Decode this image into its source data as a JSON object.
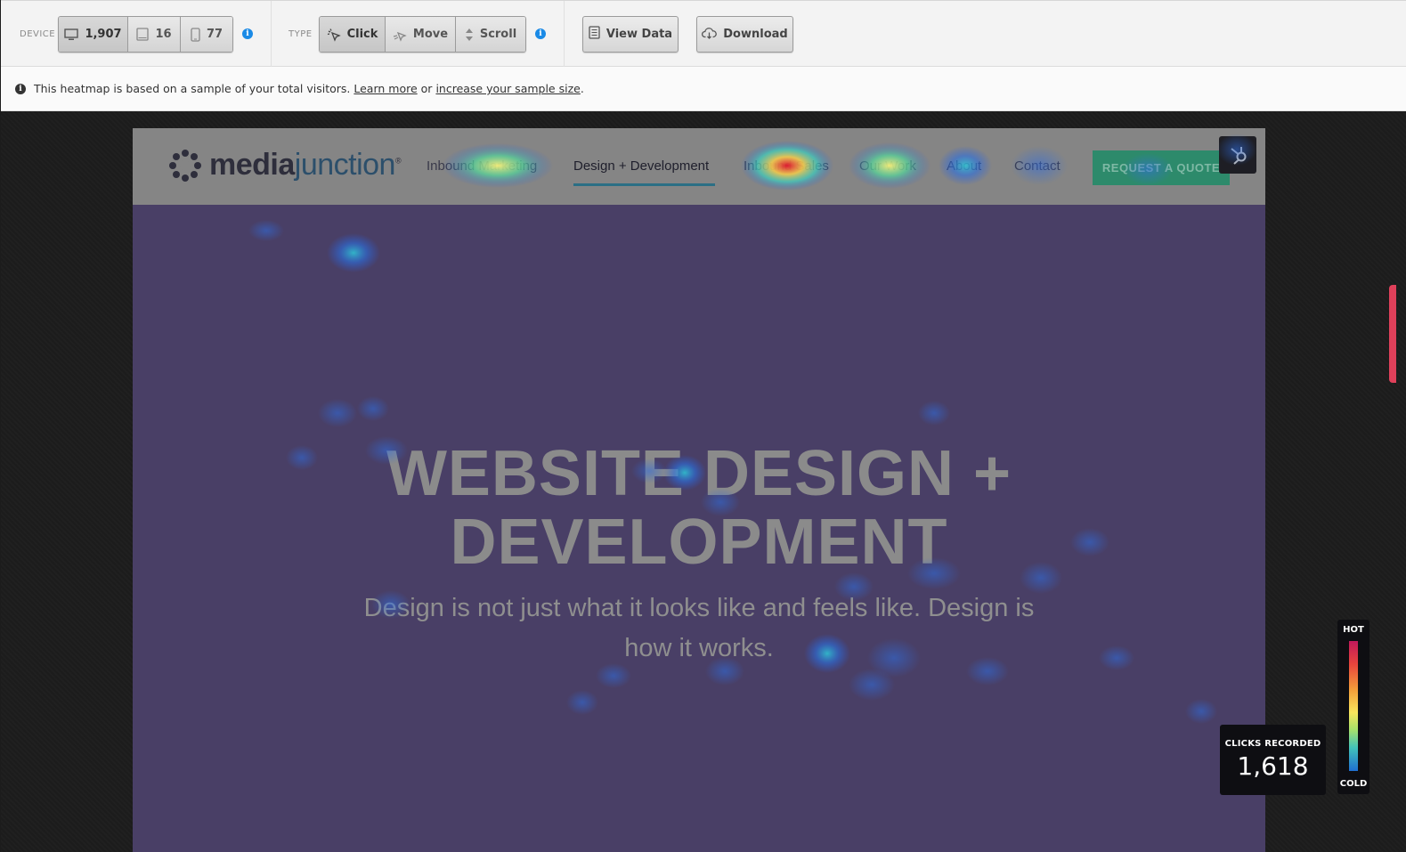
{
  "toolbar": {
    "device_label": "DEVICE",
    "devices": [
      {
        "icon": "desktop-icon",
        "count": "1,907",
        "active": true
      },
      {
        "icon": "tablet-icon",
        "count": "16",
        "active": false
      },
      {
        "icon": "phone-icon",
        "count": "77",
        "active": false
      }
    ],
    "type_label": "TYPE",
    "types": [
      {
        "icon": "click-icon",
        "label": "Click",
        "active": true
      },
      {
        "icon": "move-icon",
        "label": "Move",
        "active": false
      },
      {
        "icon": "scroll-icon",
        "label": "Scroll",
        "active": false
      }
    ],
    "view_data": "View Data",
    "download": "Download"
  },
  "notice": {
    "text": "This heatmap is based on a sample of your total visitors.",
    "learn_more": "Learn more",
    "or": "or",
    "increase": "increase your sample size",
    "period": "."
  },
  "site": {
    "logo_text_a": "media",
    "logo_text_b": "junction",
    "logo_mark": "®",
    "nav": [
      "Inbound Marketing",
      "Design + Development",
      "Inbound Sales",
      "Our Work",
      "About",
      "Contact"
    ],
    "cta": "REQUEST A QUOTE",
    "hero_line1": "WEBSITE DESIGN +",
    "hero_line2": "DEVELOPMENT",
    "hero_sub": "Design is not just what it looks like and feels like. Design is how it works."
  },
  "stats": {
    "clicks_label": "CLICKS RECORDED",
    "clicks_value": "1,618"
  },
  "legend": {
    "hot": "HOT",
    "cold": "COLD"
  },
  "colors": {
    "page_bg": "#493f66",
    "header_bg": "#858585",
    "cta_bg": "#2d8a6b",
    "info_blue": "#1a8ae6",
    "scroll_marker": "#e0405a"
  }
}
